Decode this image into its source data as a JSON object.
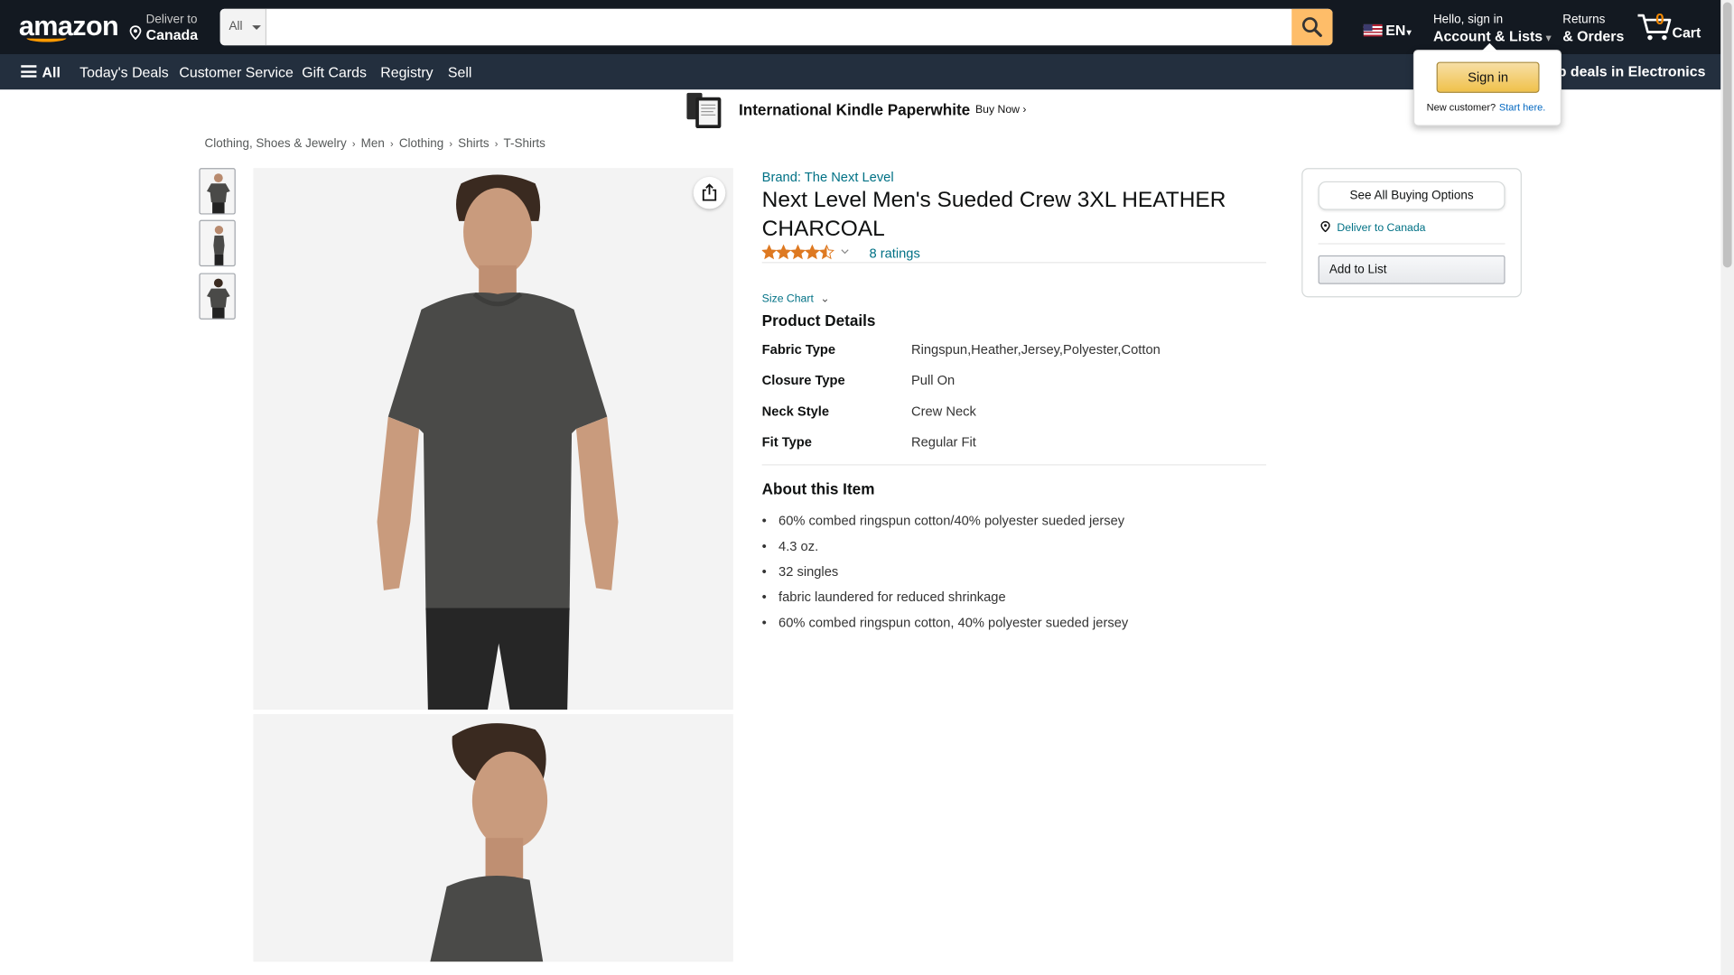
{
  "header": {
    "logo": "amazon",
    "deliver_label": "Deliver to",
    "deliver_location": "Canada",
    "search_department": "All",
    "search_placeholder": "",
    "language": "EN",
    "account_greeting": "Hello, sign in",
    "account_label": "Account & Lists",
    "returns_label": "Returns",
    "orders_label": "& Orders",
    "cart_count": "0",
    "cart_label": "Cart"
  },
  "subnav": {
    "all_label": "All",
    "items": [
      "Today's Deals",
      "Customer Service",
      "Gift Cards",
      "Registry",
      "Sell"
    ],
    "promo": "Shop deals in Electronics"
  },
  "signin_flyout": {
    "button": "Sign in",
    "new_customer": "New customer?",
    "start_here": "Start here."
  },
  "banner": {
    "title": "International Kindle Paperwhite",
    "cta": "Buy Now ›"
  },
  "breadcrumb": [
    "Clothing, Shoes & Jewelry",
    "Men",
    "Clothing",
    "Shirts",
    "T-Shirts"
  ],
  "product": {
    "brand": "Brand: The Next Level",
    "title": "Next Level Men's Sueded Crew 3XL HEATHER CHARCOAL",
    "rating": 4.5,
    "ratings_count": "8 ratings",
    "size_chart": "Size Chart",
    "details_heading": "Product Details",
    "details": [
      {
        "key": "Fabric Type",
        "value": "Ringspun,Heather,Jersey,Polyester,Cotton"
      },
      {
        "key": "Closure Type",
        "value": "Pull On"
      },
      {
        "key": "Neck Style",
        "value": "Crew Neck"
      },
      {
        "key": "Fit Type",
        "value": "Regular Fit"
      }
    ],
    "about_heading": "About this Item",
    "about": [
      "60% combed ringspun cotton/40% polyester sueded jersey",
      "4.3 oz.",
      "32 singles",
      "fabric laundered for reduced shrinkage",
      "60% combed ringspun cotton, 40% polyester sueded jersey"
    ]
  },
  "buybox": {
    "see_all": "See All Buying Options",
    "deliver": "Deliver to Canada",
    "add_to_list": "Add to List"
  },
  "colors": {
    "nav_bg": "#131921",
    "subnav_bg": "#232f3e",
    "accent": "#febd69",
    "link": "#007185",
    "star": "#de7921",
    "shirt": "#4a4a48"
  }
}
